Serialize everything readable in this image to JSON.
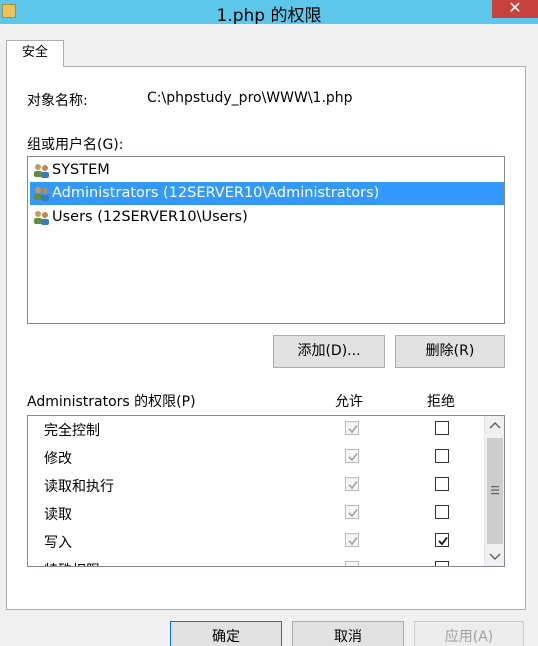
{
  "window": {
    "title": "1.php 的权限",
    "close_label": "✕"
  },
  "tabs": [
    {
      "label": "安全"
    }
  ],
  "object": {
    "label": "对象名称:",
    "value": "C:\\phpstudy_pro\\WWW\\1.php"
  },
  "groups": {
    "label": "组或用户名(G):",
    "items": [
      {
        "label": "SYSTEM",
        "selected": false
      },
      {
        "label": "Administrators (12SERVER10\\Administrators)",
        "selected": true
      },
      {
        "label": "Users (12SERVER10\\Users)",
        "selected": false
      }
    ],
    "add_label": "添加(D)...",
    "remove_label": "删除(R)"
  },
  "permissions": {
    "label": "Administrators 的权限(P)",
    "allow_header": "允许",
    "deny_header": "拒绝",
    "rows": [
      {
        "name": "完全控制",
        "allow": true,
        "deny": false
      },
      {
        "name": "修改",
        "allow": true,
        "deny": false
      },
      {
        "name": "读取和执行",
        "allow": true,
        "deny": false
      },
      {
        "name": "读取",
        "allow": true,
        "deny": false
      },
      {
        "name": "写入",
        "allow": true,
        "deny": true
      },
      {
        "name": "特殊权限",
        "allow": false,
        "deny": false
      }
    ]
  },
  "footer": {
    "ok_label": "确定",
    "cancel_label": "取消",
    "apply_label": "应用(A)"
  },
  "colors": {
    "title_bar": "#5cc7ea",
    "close_button": "#c7413e",
    "selection": "#3399ff"
  }
}
